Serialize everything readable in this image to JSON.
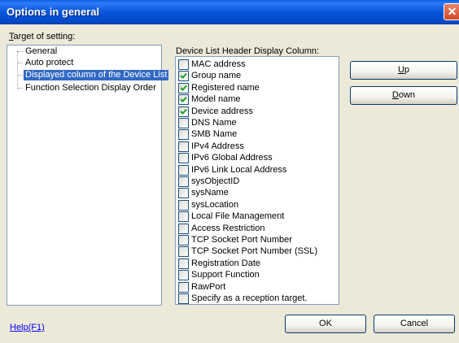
{
  "window": {
    "title": "Options in general",
    "close_glyph": "✕"
  },
  "target": {
    "label_underlined": "T",
    "label_rest": "arget of setting:",
    "items": [
      {
        "label": "General",
        "selected": false
      },
      {
        "label": "Auto protect",
        "selected": false
      },
      {
        "label": "Displayed column of the Device List",
        "selected": true
      },
      {
        "label": "Function Selection Display Order",
        "selected": false
      }
    ]
  },
  "columns": {
    "label": "Device List Header Display Column:",
    "items": [
      {
        "label": "MAC address",
        "checked": false
      },
      {
        "label": "Group name",
        "checked": true
      },
      {
        "label": "Registered name",
        "checked": true
      },
      {
        "label": "Model name",
        "checked": true
      },
      {
        "label": "Device address",
        "checked": true
      },
      {
        "label": "DNS Name",
        "checked": false
      },
      {
        "label": "SMB Name",
        "checked": false
      },
      {
        "label": "IPv4 Address",
        "checked": false
      },
      {
        "label": "IPv6 Global Address",
        "checked": false
      },
      {
        "label": "IPv6 Link Local Address",
        "checked": false
      },
      {
        "label": "sysObjectID",
        "checked": false
      },
      {
        "label": "sysName",
        "checked": false
      },
      {
        "label": "sysLocation",
        "checked": false
      },
      {
        "label": "Local File Management",
        "checked": false
      },
      {
        "label": "Access Restriction",
        "checked": false
      },
      {
        "label": "TCP Socket Port Number",
        "checked": false
      },
      {
        "label": "TCP Socket Port Number (SSL)",
        "checked": false
      },
      {
        "label": "Registration Date",
        "checked": false
      },
      {
        "label": "Support Function",
        "checked": false
      },
      {
        "label": "RawPort",
        "checked": false
      },
      {
        "label": "Specify as a reception target.",
        "checked": false
      }
    ]
  },
  "buttons": {
    "up_underlined": "U",
    "up_rest": "p",
    "down_underlined": "D",
    "down_rest": "own",
    "ok": "OK",
    "cancel": "Cancel"
  },
  "help": {
    "label": "Help(F1)"
  }
}
